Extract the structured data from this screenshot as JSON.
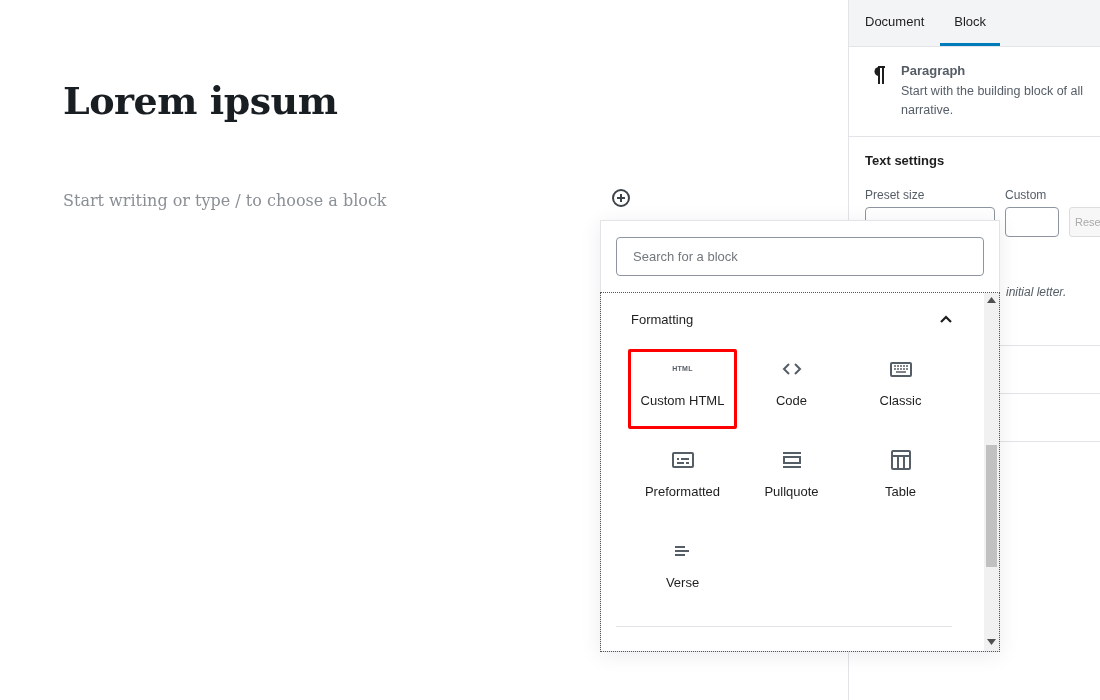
{
  "editor": {
    "title": "Lorem ipsum",
    "placeholder": "Start writing or type / to choose a block"
  },
  "sidebar": {
    "tabs": [
      {
        "label": "Document",
        "selected": false
      },
      {
        "label": "Block",
        "selected": true
      }
    ],
    "block_card": {
      "title": "Paragraph",
      "description": "Start with the building block of all narrative."
    },
    "text_settings": {
      "title": "Text settings",
      "preset_label": "Preset size",
      "custom_label": "Custom",
      "reset_button": "Rese",
      "hint": "initial letter."
    }
  },
  "inserter": {
    "search_placeholder": "Search for a block",
    "category": {
      "title": "Formatting",
      "expanded": true
    },
    "blocks": [
      {
        "label": "Custom HTML",
        "kind": "html",
        "icon_text": "HTML",
        "selected": true
      },
      {
        "label": "Code",
        "kind": "code",
        "selected": false
      },
      {
        "label": "Classic",
        "kind": "keyboard",
        "selected": false
      },
      {
        "label": "Preformatted",
        "kind": "preformatted",
        "selected": false
      },
      {
        "label": "Pullquote",
        "kind": "pullquote",
        "selected": false
      },
      {
        "label": "Table",
        "kind": "table",
        "selected": false
      },
      {
        "label": "Verse",
        "kind": "verse",
        "selected": false
      }
    ]
  }
}
